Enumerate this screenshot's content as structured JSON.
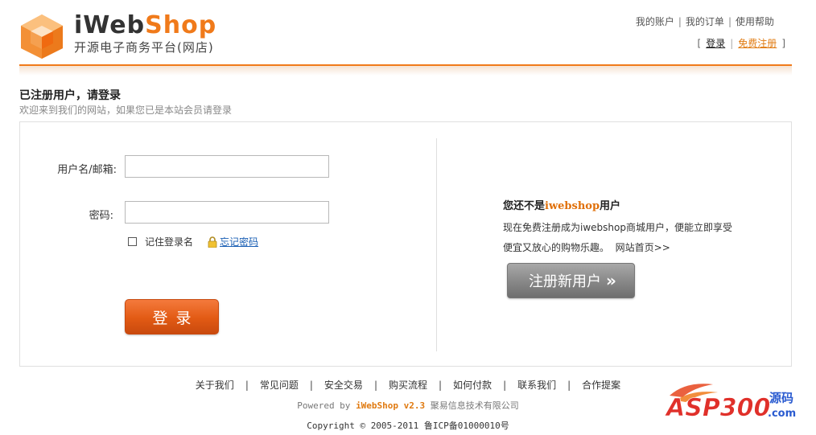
{
  "header": {
    "brand_a": "iWeb",
    "brand_b": "Shop",
    "subtitle": "开源电子商务平台(网店)",
    "top_links": [
      "我的账户",
      "我的订单",
      "使用帮助"
    ],
    "login": "登录",
    "register": "免费注册"
  },
  "title": {
    "heading": "已注册用户，请登录",
    "sub": "欢迎来到我们的网站，如果您已是本站会员请登录"
  },
  "login_form": {
    "username_label": "用户名/邮箱:",
    "username_value": "",
    "password_label": "密码:",
    "password_value": "",
    "remember_label": "记住登录名",
    "remember_checked": false,
    "forgot_label": "忘记密码",
    "submit_label": "登录"
  },
  "register_panel": {
    "title_pre": "您还不是",
    "title_brand": "iwebshop",
    "title_post": "用户",
    "desc_line1": "现在免费注册成为iwebshop商城用户，便能立即享受",
    "desc_line2": "便宜又放心的购物乐趣。",
    "home_link": "网站首页>>",
    "button_label": "注册新用户",
    "button_arrows": "»"
  },
  "footer": {
    "links": [
      "关于我们",
      "常见问题",
      "安全交易",
      "购买流程",
      "如何付款",
      "联系我们",
      "合作提案"
    ],
    "powered_pre": "Powered by ",
    "powered_brand": "iWebShop v2.3",
    "powered_post": " 聚易信息技术有限公司",
    "copyright": "Copyright © 2005-2011 鲁ICP备01000010号"
  },
  "watermark": {
    "text_a": "ASP300",
    "text_b": "源码",
    "text_c": ".com"
  },
  "colors": {
    "accent": "#f07a1a",
    "login_button": "#e25a14",
    "register_button": "#8a8a8a"
  }
}
